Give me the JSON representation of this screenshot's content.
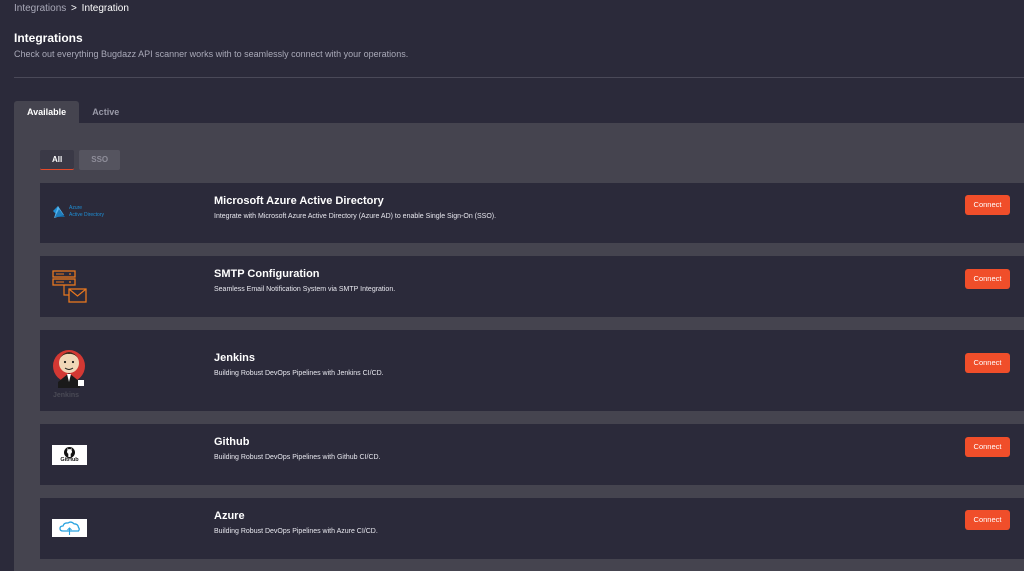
{
  "breadcrumb": {
    "parent": "Integrations",
    "separator": ">",
    "current": "Integration"
  },
  "header": {
    "title": "Integrations",
    "subtitle": "Check out everything Bugdazz API scanner works with to seamlessly connect with your operations."
  },
  "tabs": [
    {
      "label": "Available",
      "active": true
    },
    {
      "label": "Active",
      "active": false
    }
  ],
  "subtabs": [
    {
      "label": "All",
      "active": true
    },
    {
      "label": "SSO",
      "active": false
    }
  ],
  "integrations": [
    {
      "name": "Microsoft Azure Active Directory",
      "description": "Integrate with Microsoft Azure Active Directory (Azure AD) to enable Single Sign-On (SSO).",
      "logo_icon": "azure-ad-icon",
      "logo_text": [
        "Azure",
        "Active Directory"
      ],
      "button": "Connect"
    },
    {
      "name": "SMTP Configuration",
      "description": "Seamless Email Notification System via SMTP Integration.",
      "logo_icon": "smtp-server-mail-icon",
      "button": "Connect"
    },
    {
      "name": "Jenkins",
      "description": "Building Robust DevOps Pipelines with Jenkins CI/CD.",
      "logo_icon": "jenkins-icon",
      "logo_text": "Jenkins",
      "button": "Connect"
    },
    {
      "name": "Github",
      "description": "Building Robust DevOps Pipelines with Github CI/CD.",
      "logo_icon": "github-icon",
      "logo_text": "GitHub",
      "button": "Connect"
    },
    {
      "name": "Azure",
      "description": "Building Robust DevOps Pipelines with Azure CI/CD.",
      "logo_icon": "azure-cloud-icon",
      "button": "Connect"
    }
  ],
  "colors": {
    "background": "#2b2a3a",
    "panel": "#45444f",
    "accent": "#f04e2a",
    "azure_blue": "#1e8fd6",
    "smtp_orange": "#e8771e"
  }
}
